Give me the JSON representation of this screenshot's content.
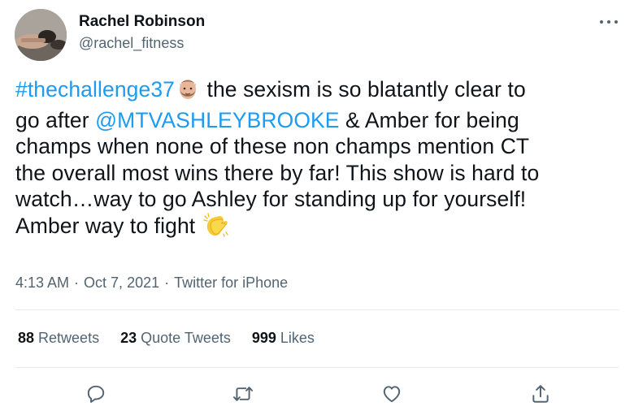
{
  "author": {
    "name": "Rachel Robinson",
    "handle": "@rachel_fitness"
  },
  "tweet": {
    "lines": [
      {
        "hashtag": "#thechallenge37",
        "emoji_after_hashtag": "man-face-emoji",
        "text": " the sexism is so blatantly clear to"
      },
      {
        "pre": "go after ",
        "mention": "@MTVASHLEYBROOKE",
        "post": " & Amber for being"
      },
      {
        "text": "champs when none of these non champs mention CT"
      },
      {
        "text": "the overall most wins there by far! This show is hard to"
      },
      {
        "text": "watch…way to go Ashley for standing up for yourself!"
      },
      {
        "text": "Amber way to fight",
        "emoji_after": "clapping-hands-emoji"
      }
    ]
  },
  "meta": {
    "time": "4:13 AM",
    "separator": "·",
    "date": "Oct 7, 2021",
    "source": "Twitter for iPhone"
  },
  "stats": {
    "retweets_count": "88",
    "retweets_label": "Retweets",
    "quotes_count": "23",
    "quotes_label": "Quote Tweets",
    "likes_count": "999",
    "likes_label": "Likes"
  },
  "actions": [
    "reply-icon",
    "retweet-icon",
    "like-icon",
    "share-icon"
  ],
  "colors": {
    "link": "#1d9bf0",
    "text": "#0f1419",
    "secondary": "#536471",
    "divider": "#e7e9ea"
  }
}
